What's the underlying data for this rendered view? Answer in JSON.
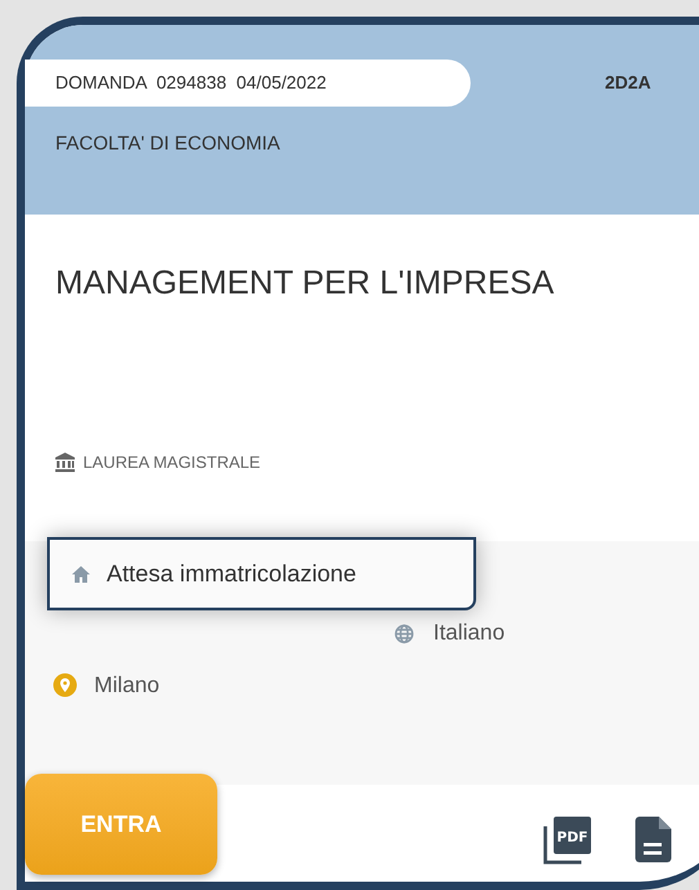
{
  "header": {
    "application": "DOMANDA  0294838  04/05/2022",
    "code": "2D2A",
    "faculty": "FACOLTA' DI ECONOMIA"
  },
  "course": {
    "title": "MANAGEMENT PER L'IMPRESA",
    "degree": "LAUREA MAGISTRALE"
  },
  "status": "Attesa immatricolazione",
  "language": "Italiano",
  "location": "Milano",
  "footer": {
    "button": "ENTRA",
    "pdf_icon_label": "PDF"
  }
}
